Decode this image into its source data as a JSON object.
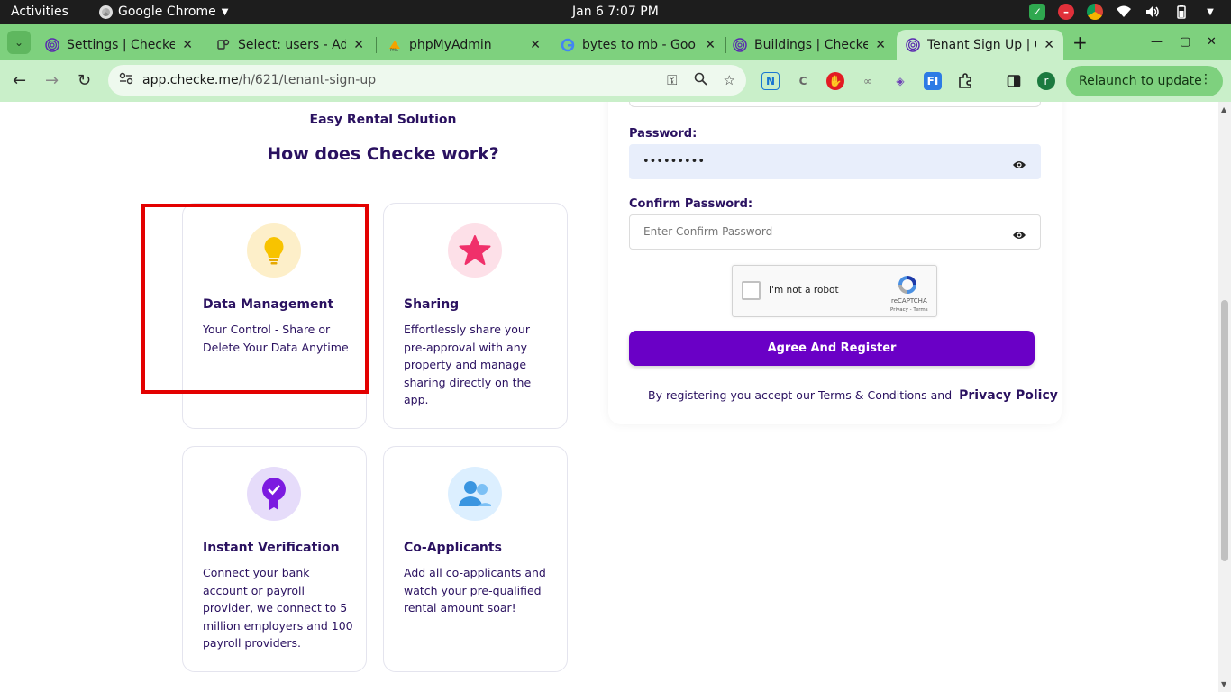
{
  "topbar": {
    "activities": "Activities",
    "app_name": "Google Chrome",
    "clock": "Jan 6   7:07 PM"
  },
  "tabs": [
    {
      "title": "Settings | Checke",
      "favicon": "fingerprint-icon"
    },
    {
      "title": "Select: users - Adr",
      "favicon": "database-icon"
    },
    {
      "title": "phpMyAdmin",
      "favicon": "phpmyadmin-icon"
    },
    {
      "title": "bytes to mb - Goo",
      "favicon": "google-icon"
    },
    {
      "title": "Buildings | Checke",
      "favicon": "fingerprint-icon"
    },
    {
      "title": "Tenant Sign Up | C",
      "favicon": "fingerprint-icon",
      "active": true
    }
  ],
  "toolbar": {
    "url_host": "app.checke.me",
    "url_path": "/h/621/tenant-sign-up",
    "profile_initial": "r",
    "relaunch": "Relaunch to update"
  },
  "page": {
    "brand_sub": "Easy Rental Solution",
    "how_title": "How does Checke work?",
    "cards": [
      {
        "title": "Data Management",
        "desc": "Your Control - Share or Delete Your Data Anytime",
        "icon": "lightbulb-icon"
      },
      {
        "title": "Sharing",
        "desc": "Effortlessly share your pre-approval with any property and manage sharing directly on the app.",
        "icon": "star-icon"
      },
      {
        "title": "Instant Verification",
        "desc": "Connect your bank account or payroll provider, we connect to 5 million employers and 100 payroll providers.",
        "icon": "verified-badge-icon"
      },
      {
        "title": "Co-Applicants",
        "desc": "Add all co-applicants and watch your pre-qualified rental amount soar!",
        "icon": "users-icon"
      }
    ]
  },
  "form": {
    "password_label": "Password:",
    "password_value": "•••••••••",
    "confirm_label": "Confirm Password:",
    "confirm_placeholder": "Enter Confirm Password",
    "captcha_text": "I'm not a robot",
    "captcha_brand": "reCAPTCHA",
    "captcha_terms": "Privacy - Terms",
    "agree_button": "Agree And Register",
    "legal_text": "By registering you accept our Terms & Conditions and",
    "privacy_link": "Privacy Policy"
  },
  "colors": {
    "accent_purple": "#6a00c6",
    "text_navy": "#2a1160",
    "tabstrip_green": "#7ed17e",
    "highlight_red": "#e30000"
  }
}
